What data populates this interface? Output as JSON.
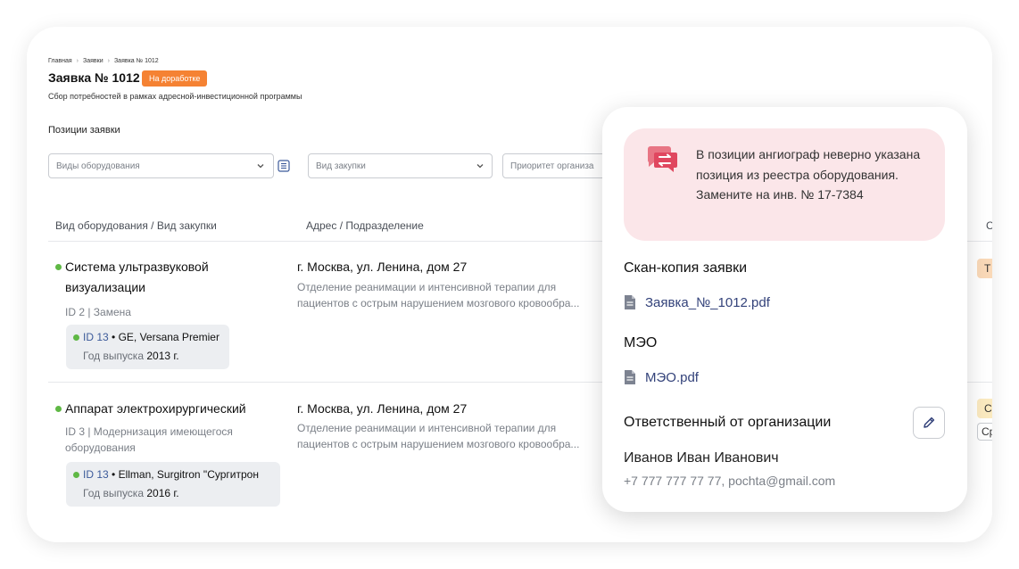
{
  "breadcrumb": [
    "Главная",
    "Заявки",
    "Заявка № 1012"
  ],
  "header": {
    "title": "Заявка № 1012",
    "status": "На доработке",
    "subtitle": "Сбор потребностей в рамках адресной-инвестиционной программы"
  },
  "positions": {
    "section_title": "Позиции заявки",
    "filters": {
      "equipment_placeholder": "Виды оборудования",
      "purchase_placeholder": "Вид закупки",
      "priority_placeholder": "Приоритет организа"
    },
    "columns": [
      "Вид оборудования / Вид закупки",
      "Адрес / Подразделение",
      "С"
    ],
    "rows": [
      {
        "name": "Система ультразвуковой визуализации",
        "meta": "ID 2 | Замена",
        "chip_id": "ID 13",
        "chip_model": "GE, Versana Premier",
        "year_label": "Год выпуска",
        "year": "2013 г.",
        "address": "г. Москва, ул. Ленина, дом 27",
        "dept_line1": "Отделение реанимации и интенсивной терапии для",
        "dept_line2": "пациентов с острым нарушением мозгового кровообра...",
        "edge_tag": "Т"
      },
      {
        "name": "Аппарат электрохирургический",
        "meta": "ID 3 | Модернизация имеющегося оборудования",
        "chip_id": "ID 13",
        "chip_model": "Ellman, Surgitron \"Сургитрон",
        "year_label": "Год выпуска",
        "year": "2016 г.",
        "address": "г. Москва, ул. Ленина, дом 27",
        "dept_line1": "Отделение реанимации и интенсивной терапии для",
        "dept_line2": "пациентов с острым нарушением мозгового кровообра...",
        "edge_tag": "С",
        "edge_tag2": "Ср"
      }
    ]
  },
  "popup": {
    "comment": "В позиции ангиограф неверно указана позиция из реестра оборудования. Замените на инв. № 17-7384",
    "scan_title": "Скан-копия заявки",
    "scan_file": "Заявка_№_1012.pdf",
    "meo_title": "МЭО",
    "meo_file": "МЭО.pdf",
    "responsible_title": "Ответственный от организации",
    "person_name": "Иванов Иван Иванович",
    "person_contact": "+7 777 777 77 77, pochta@gmail.com"
  },
  "colors": {
    "status_badge": "#f58233",
    "comment_bg": "#fbe6e9",
    "comment_icon": "#e0475f",
    "link": "#33427a",
    "active_dot": "#5fb845"
  },
  "icons": {
    "comment": "chat-swap-icon",
    "file": "document-icon",
    "edit": "pencil-icon",
    "chevron": "chevron-down-icon",
    "list": "list-icon"
  }
}
